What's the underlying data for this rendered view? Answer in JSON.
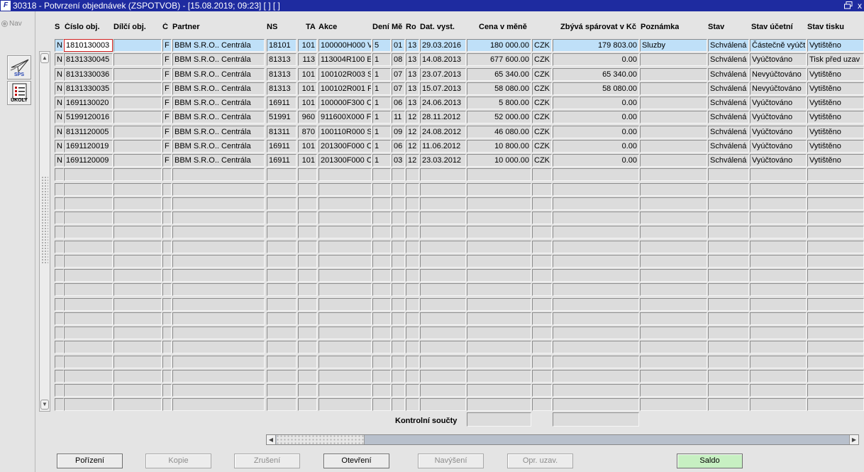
{
  "window": {
    "title": "30318 - Potvrzení objednávek (ZSPOTVOB) - [15.08.2019; 09:23]  [ ]  [ ]",
    "app_icon_text": "F",
    "close_glyph": "x"
  },
  "left_panel": {
    "nav_label": "Nav",
    "sps_button_caption": "SPS",
    "ukoly_button_caption": "ÚKOLY"
  },
  "table": {
    "columns": [
      "S",
      "Číslo obj.",
      "Dílčí obj.",
      "Č",
      "Partner",
      "NS",
      "TA",
      "Akce",
      "Dení",
      "Mě",
      "Ro",
      "Dat. vyst.",
      "Cena v měně",
      "",
      "Zbývá spárovat v Kč",
      "Poznámka",
      "Stav",
      "Stav účetní",
      "Stav tisku"
    ],
    "rows": [
      [
        "N",
        "1810130003",
        "",
        "F",
        "BBM S.R.O.. Centrála",
        "18101",
        "101",
        "100000H000 V",
        "5",
        "01",
        "13",
        "29.03.2016",
        "180 000.00",
        "CZK",
        "179 803.00",
        "Sluzby",
        "Schválená",
        "Částečně vyúčt",
        "Vytištěno"
      ],
      [
        "N",
        "8131330045",
        "",
        "F",
        "BBM S.R.O.. Centrála",
        "81313",
        "113",
        "113004R100 E",
        "1",
        "08",
        "13",
        "14.08.2013",
        "677 600.00",
        "CZK",
        "0.00",
        "",
        "Schválená",
        "Vyúčtováno",
        "Tisk před uzav"
      ],
      [
        "N",
        "8131330036",
        "",
        "F",
        "BBM S.R.O.. Centrála",
        "81313",
        "101",
        "100102R003 S",
        "1",
        "07",
        "13",
        "23.07.2013",
        "65 340.00",
        "CZK",
        "65 340.00",
        "",
        "Schválená",
        "Nevyúčtováno",
        "Vytištěno"
      ],
      [
        "N",
        "8131330035",
        "",
        "F",
        "BBM S.R.O.. Centrála",
        "81313",
        "101",
        "100102R001 F",
        "1",
        "07",
        "13",
        "15.07.2013",
        "58 080.00",
        "CZK",
        "58 080.00",
        "",
        "Schválená",
        "Nevyúčtováno",
        "Vytištěno"
      ],
      [
        "N",
        "1691130020",
        "",
        "F",
        "BBM S.R.O.. Centrála",
        "16911",
        "101",
        "100000F300 C",
        "1",
        "06",
        "13",
        "24.06.2013",
        "5 800.00",
        "CZK",
        "0.00",
        "",
        "Schválená",
        "Vyúčtováno",
        "Vytištěno"
      ],
      [
        "N",
        "5199120016",
        "",
        "F",
        "BBM S.R.O.. Centrála",
        "51991",
        "960",
        "911600X000 F",
        "1",
        "11",
        "12",
        "28.11.2012",
        "52 000.00",
        "CZK",
        "0.00",
        "",
        "Schválená",
        "Vyúčtováno",
        "Vytištěno"
      ],
      [
        "N",
        "8131120005",
        "",
        "F",
        "BBM S.R.O.. Centrála",
        "81311",
        "870",
        "100110R000 S",
        "1",
        "09",
        "12",
        "24.08.2012",
        "46 080.00",
        "CZK",
        "0.00",
        "",
        "Schválená",
        "Vyúčtováno",
        "Vytištěno"
      ],
      [
        "N",
        "1691120019",
        "",
        "F",
        "BBM S.R.O.. Centrála",
        "16911",
        "101",
        "201300F000 C",
        "1",
        "06",
        "12",
        "11.06.2012",
        "10 800.00",
        "CZK",
        "0.00",
        "",
        "Schválená",
        "Vyúčtováno",
        "Vytištěno"
      ],
      [
        "N",
        "1691120009",
        "",
        "F",
        "BBM S.R.O.. Centrála",
        "16911",
        "101",
        "201300F000 C",
        "1",
        "03",
        "12",
        "23.03.2012",
        "10 000.00",
        "CZK",
        "0.00",
        "",
        "Schválená",
        "Vyúčtováno",
        "Vytištěno"
      ]
    ],
    "selected_row": 0
  },
  "totals": {
    "label": "Kontrolní součty",
    "cena_total": "",
    "zbyva_total": ""
  },
  "buttons": [
    {
      "label": "Pořízení",
      "enabled": true
    },
    {
      "label": "Kopie",
      "enabled": false
    },
    {
      "label": "Zrušení",
      "enabled": false
    },
    {
      "label": "Otevření",
      "enabled": true
    },
    {
      "label": "Navýšení",
      "enabled": false
    },
    {
      "label": "Opr. uzav.",
      "enabled": false
    },
    {
      "label": "Saldo",
      "enabled": true
    }
  ],
  "colors": {
    "titlebar": "#1e2ba0",
    "selected_row": "#bfe0f8",
    "focus_border": "#d02020",
    "saldo_button": "#c7f0c2"
  }
}
